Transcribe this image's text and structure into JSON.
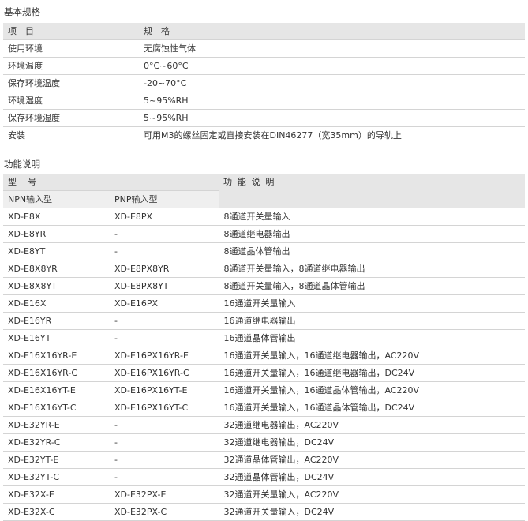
{
  "basic": {
    "title": "基本规格",
    "headers": [
      "项　目",
      "规　格"
    ],
    "rows": [
      [
        "使用环境",
        "无腐蚀性气体"
      ],
      [
        "环境温度",
        "0°C~60°C"
      ],
      [
        "保存环境温度",
        "-20~70°C"
      ],
      [
        "环境湿度",
        "5~95%RH"
      ],
      [
        "保存环境湿度",
        "5~95%RH"
      ],
      [
        "安装",
        "可用M3的螺丝固定或直接安装在DIN46277（宽35mm）的导轨上"
      ]
    ]
  },
  "func": {
    "title": "功能说明",
    "header_model": "型　号",
    "header_func": "功 能 说 明",
    "sub_npn": "NPN输入型",
    "sub_pnp": "PNP输入型",
    "rows": [
      [
        "XD-E8X",
        "XD-E8PX",
        "8通道开关量输入"
      ],
      [
        "XD-E8YR",
        "-",
        "8通道继电器输出"
      ],
      [
        "XD-E8YT",
        "-",
        "8通道晶体管输出"
      ],
      [
        "XD-E8X8YR",
        "XD-E8PX8YR",
        "8通道开关量输入，8通道继电器输出"
      ],
      [
        "XD-E8X8YT",
        "XD-E8PX8YT",
        "8通道开关量输入，8通道晶体管输出"
      ],
      [
        "XD-E16X",
        "XD-E16PX",
        "16通道开关量输入"
      ],
      [
        "XD-E16YR",
        "-",
        "16通道继电器输出"
      ],
      [
        "XD-E16YT",
        "-",
        "16通道晶体管输出"
      ],
      [
        "XD-E16X16YR-E",
        "XD-E16PX16YR-E",
        "16通道开关量输入，16通道继电器输出，AC220V"
      ],
      [
        "XD-E16X16YR-C",
        "XD-E16PX16YR-C",
        "16通道开关量输入，16通道继电器输出，DC24V"
      ],
      [
        "XD-E16X16YT-E",
        "XD-E16PX16YT-E",
        "16通道开关量输入，16通道晶体管输出，AC220V"
      ],
      [
        "XD-E16X16YT-C",
        "XD-E16PX16YT-C",
        "16通道开关量输入，16通道晶体管输出，DC24V"
      ],
      [
        "XD-E32YR-E",
        "-",
        "32通道继电器输出，AC220V"
      ],
      [
        "XD-E32YR-C",
        "-",
        "32通道继电器输出，DC24V"
      ],
      [
        "XD-E32YT-E",
        "-",
        "32通道晶体管输出，AC220V"
      ],
      [
        "XD-E32YT-C",
        "-",
        "32通道晶体管输出，DC24V"
      ],
      [
        "XD-E32X-E",
        "XD-E32PX-E",
        "32通道开关量输入，AC220V"
      ],
      [
        "XD-E32X-C",
        "XD-E32PX-C",
        "32通道开关量输入，DC24V"
      ]
    ]
  }
}
